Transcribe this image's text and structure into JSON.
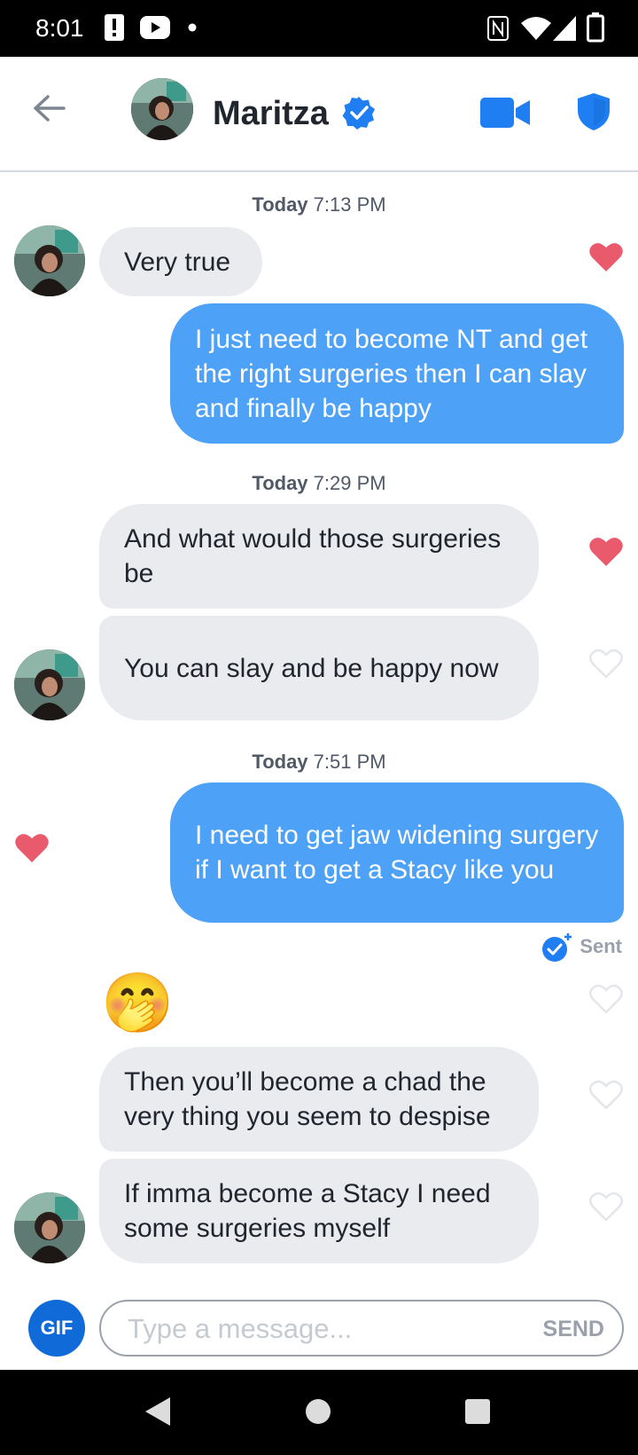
{
  "status_bar": {
    "time": "8:01",
    "icons": [
      "alert-icon",
      "youtube-icon",
      "dot-icon",
      "nfc-icon",
      "wifi-icon",
      "signal-icon",
      "battery-icon"
    ]
  },
  "header": {
    "back_icon": "arrow-left-icon",
    "contact_name": "Maritza",
    "verified_icon": "verified-badge-icon",
    "video_icon": "video-camera-icon",
    "shield_icon": "shield-icon",
    "accent_color": "#1e7ef2"
  },
  "messages": [
    {
      "type": "timestamp",
      "day": "Today",
      "time": "7:13 PM"
    },
    {
      "type": "received",
      "text": "Very true",
      "liked": true
    },
    {
      "type": "sent",
      "text": "I just need to become NT and get the right surgeries then I can slay and finally be happy"
    },
    {
      "type": "timestamp",
      "day": "Today",
      "time": "7:29 PM"
    },
    {
      "type": "received",
      "text": "And what would those surgeries be",
      "liked": true
    },
    {
      "type": "received",
      "text": "You can slay and be happy now",
      "liked": false
    },
    {
      "type": "timestamp",
      "day": "Today",
      "time": "7:51 PM"
    },
    {
      "type": "sent",
      "text": "I need to get jaw widening surgery if I want to get a Stacy like you",
      "liked": true
    },
    {
      "type": "status",
      "text": "Sent"
    },
    {
      "type": "received-emoji",
      "emoji": "🤭",
      "liked": false
    },
    {
      "type": "received",
      "text": "Then you’ll become a chad the very thing you seem to despise",
      "liked": false
    },
    {
      "type": "received",
      "text": "If imma become a Stacy I need some surgeries myself",
      "liked": false
    }
  ],
  "composer": {
    "gif_label": "GIF",
    "placeholder": "Type a message...",
    "send_label": "SEND"
  },
  "colors": {
    "sent_bubble": "#4da1f7",
    "received_bubble": "#e9ebef",
    "heart_liked": "#ea5a6d",
    "heart_outline": "#e3e6ea"
  }
}
